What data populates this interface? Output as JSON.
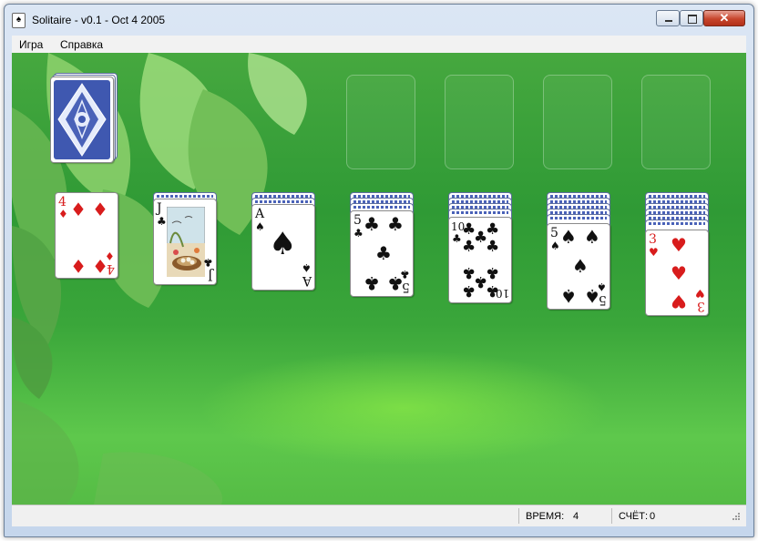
{
  "window": {
    "title": "Solitaire - v0.1 - Oct  4 2005",
    "app_icon": "♠",
    "close_label": "✕"
  },
  "menu": {
    "items": [
      "Игра",
      "Справка"
    ]
  },
  "status": {
    "time_label": "ВРЕМЯ:",
    "time_value": "4",
    "score_label": "СЧЁТ:",
    "score_value": "0"
  },
  "colors": {
    "felt": "#3aa63a",
    "red_suit": "#d81c1c",
    "card_back": "#4a62b8"
  },
  "board": {
    "stock": {
      "face_down": true
    },
    "foundations": [
      {
        "empty": true
      },
      {
        "empty": true
      },
      {
        "empty": true
      },
      {
        "empty": true
      }
    ],
    "tableau": [
      {
        "hidden_cards": 0,
        "top": {
          "rank": "4",
          "suit": "♦",
          "color": "red"
        }
      },
      {
        "hidden_cards": 1,
        "top": {
          "rank": "J",
          "suit": "♣",
          "color": "black"
        }
      },
      {
        "hidden_cards": 2,
        "top": {
          "rank": "A",
          "suit": "♠",
          "color": "black"
        }
      },
      {
        "hidden_cards": 3,
        "top": {
          "rank": "5",
          "suit": "♣",
          "color": "black"
        }
      },
      {
        "hidden_cards": 4,
        "top": {
          "rank": "10",
          "suit": "♣",
          "color": "black"
        }
      },
      {
        "hidden_cards": 5,
        "top": {
          "rank": "5",
          "suit": "♠",
          "color": "black"
        }
      },
      {
        "hidden_cards": 6,
        "top": {
          "rank": "3",
          "suit": "♥",
          "color": "red"
        }
      }
    ]
  }
}
